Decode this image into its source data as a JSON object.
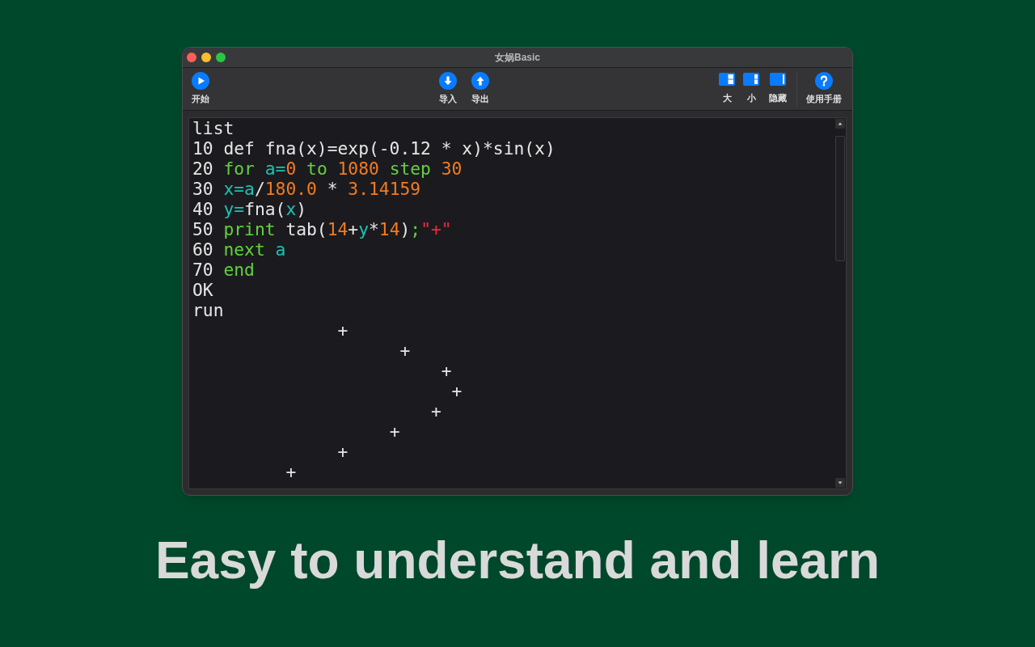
{
  "window": {
    "title": "女娲Basic"
  },
  "toolbar": {
    "start": {
      "label": "开始"
    },
    "transfer": [
      {
        "label": "导入"
      },
      {
        "label": "导出"
      }
    ],
    "layout": [
      {
        "label": "大"
      },
      {
        "label": "小"
      },
      {
        "label": "隐藏"
      }
    ],
    "help": {
      "label": "使用手册"
    }
  },
  "console": {
    "lines": [
      {
        "segments": [
          {
            "text": "list",
            "kind": "plain"
          }
        ]
      },
      {
        "segments": [
          {
            "text": "10 def fna(x)=exp(-0.12 * x)*sin(x)",
            "kind": "plain"
          }
        ]
      },
      {
        "segments": [
          {
            "text": "20 ",
            "kind": "plain"
          },
          {
            "text": "for ",
            "kind": "keyword"
          },
          {
            "text": "a=",
            "kind": "variable"
          },
          {
            "text": "0 ",
            "kind": "number"
          },
          {
            "text": "to ",
            "kind": "keyword"
          },
          {
            "text": "1080 ",
            "kind": "number"
          },
          {
            "text": "step ",
            "kind": "keyword"
          },
          {
            "text": "30",
            "kind": "number"
          }
        ]
      },
      {
        "segments": [
          {
            "text": "30 ",
            "kind": "plain"
          },
          {
            "text": "x=a",
            "kind": "variable"
          },
          {
            "text": "/",
            "kind": "plain"
          },
          {
            "text": "180.0",
            "kind": "number"
          },
          {
            "text": " * ",
            "kind": "plain"
          },
          {
            "text": "3.14159",
            "kind": "number"
          }
        ]
      },
      {
        "segments": [
          {
            "text": "40 ",
            "kind": "plain"
          },
          {
            "text": "y=",
            "kind": "variable"
          },
          {
            "text": "fna(",
            "kind": "plain"
          },
          {
            "text": "x",
            "kind": "variable"
          },
          {
            "text": ")",
            "kind": "plain"
          }
        ]
      },
      {
        "segments": [
          {
            "text": "50 ",
            "kind": "plain"
          },
          {
            "text": "print ",
            "kind": "keyword"
          },
          {
            "text": "tab(",
            "kind": "plain"
          },
          {
            "text": "14",
            "kind": "number"
          },
          {
            "text": "+",
            "kind": "plain"
          },
          {
            "text": "y",
            "kind": "variable"
          },
          {
            "text": "*",
            "kind": "plain"
          },
          {
            "text": "14",
            "kind": "number"
          },
          {
            "text": ")",
            "kind": "plain"
          },
          {
            "text": ";",
            "kind": "keyword"
          },
          {
            "text": "\"+\"",
            "kind": "string"
          }
        ]
      },
      {
        "segments": [
          {
            "text": "60 ",
            "kind": "plain"
          },
          {
            "text": "next ",
            "kind": "keyword"
          },
          {
            "text": "a",
            "kind": "variable"
          }
        ]
      },
      {
        "segments": [
          {
            "text": "70 ",
            "kind": "plain"
          },
          {
            "text": "end",
            "kind": "keyword"
          }
        ]
      },
      {
        "segments": [
          {
            "text": "OK",
            "kind": "plain"
          }
        ]
      },
      {
        "segments": [
          {
            "text": "run",
            "kind": "plain"
          }
        ]
      },
      {
        "segments": [
          {
            "text": "              +",
            "kind": "plain"
          }
        ]
      },
      {
        "segments": [
          {
            "text": "                    +",
            "kind": "plain"
          }
        ]
      },
      {
        "segments": [
          {
            "text": "                        +",
            "kind": "plain"
          }
        ]
      },
      {
        "segments": [
          {
            "text": "                         +",
            "kind": "plain"
          }
        ]
      },
      {
        "segments": [
          {
            "text": "                       +",
            "kind": "plain"
          }
        ]
      },
      {
        "segments": [
          {
            "text": "                   +",
            "kind": "plain"
          }
        ]
      },
      {
        "segments": [
          {
            "text": "              +",
            "kind": "plain"
          }
        ]
      },
      {
        "segments": [
          {
            "text": "         +",
            "kind": "plain"
          }
        ]
      }
    ]
  },
  "caption": "Easy to understand and learn"
}
